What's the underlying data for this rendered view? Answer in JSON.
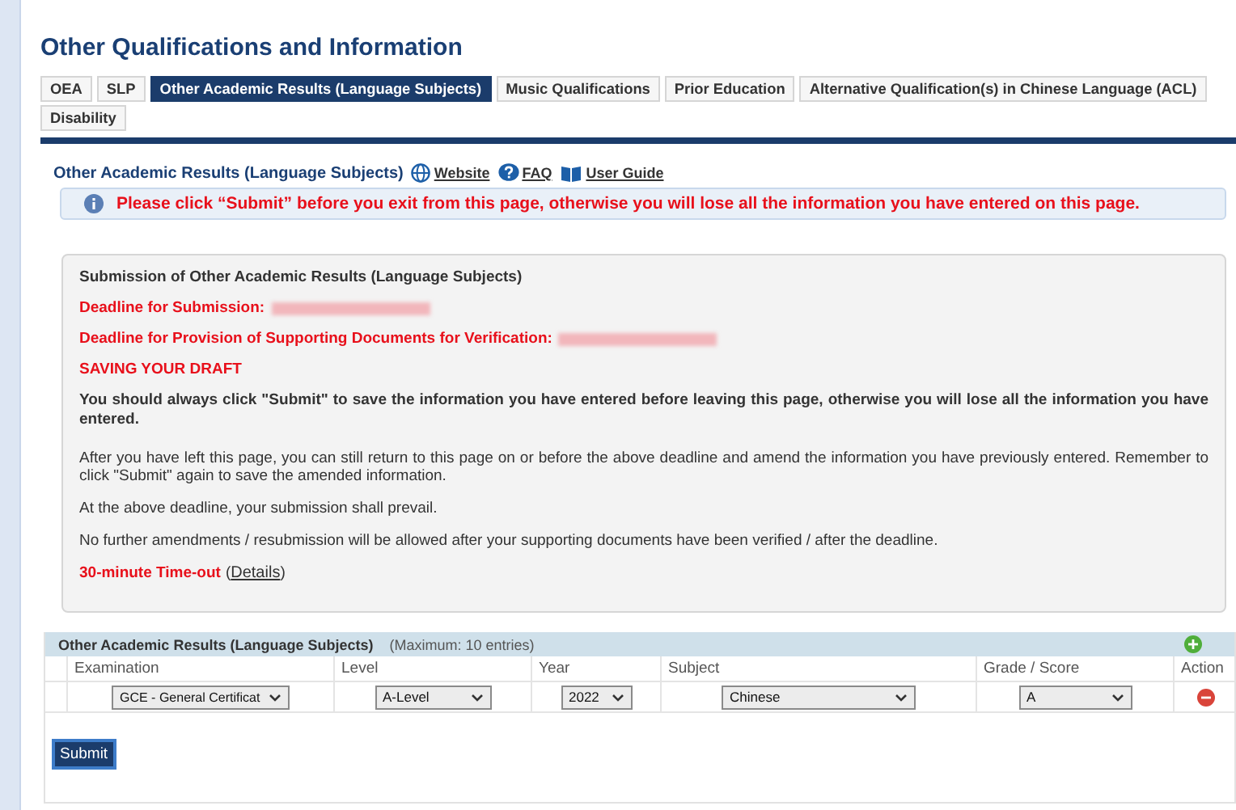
{
  "page_title": "Other Qualifications and Information",
  "tabs": [
    {
      "label": "OEA",
      "selected": false
    },
    {
      "label": "SLP",
      "selected": false
    },
    {
      "label": "Other Academic Results (Language Subjects)",
      "selected": true
    },
    {
      "label": "Music Qualifications",
      "selected": false
    },
    {
      "label": "Prior Education",
      "selected": false
    },
    {
      "label": "Alternative Qualification(s) in Chinese Language (ACL)",
      "selected": false
    },
    {
      "label": "Disability",
      "selected": false
    }
  ],
  "section": {
    "title": "Other Academic Results (Language Subjects)",
    "links": [
      {
        "kind": "website",
        "label": "Website"
      },
      {
        "kind": "faq",
        "label": "FAQ"
      },
      {
        "kind": "guide",
        "label": "User Guide"
      }
    ]
  },
  "alert": "Please click “Submit” before you exit from this page, otherwise you will lose all the information you have entered on this page.",
  "notice": {
    "heading": "Submission of Other Academic Results (Language Subjects)",
    "deadlines": [
      {
        "label": "Deadline for Submission:"
      },
      {
        "label": "Deadline for Provision of Supporting Documents for Verification:"
      }
    ],
    "draft_heading": "SAVING YOUR DRAFT",
    "warning": "You should always click \"Submit\" to save the information you have entered before leaving this page, otherwise you will lose all the information you have entered.",
    "paragraphs": [
      "After you have left this page, you can still return to this page on or before the above deadline and amend the information you have previously entered. Remember to click \"Submit\" again to save the amended information.",
      "At the above deadline, your submission shall prevail.",
      "No further amendments / resubmission will be allowed after your supporting documents have been verified / after the deadline."
    ],
    "timeout": "30-minute Time-out",
    "details_open": "(",
    "details_link": "Details",
    "details_close": ")"
  },
  "table": {
    "title": "Other Academic Results (Language Subjects)",
    "note": "(Maximum: 10 entries)",
    "columns": [
      "Examination",
      "Level",
      "Year",
      "Subject",
      "Grade / Score",
      "Action"
    ],
    "rows": [
      {
        "examination": "GCE - General Certificat",
        "level": "A-Level",
        "year": "2022",
        "subject": "Chinese",
        "grade": "A"
      }
    ]
  },
  "submit_button": "Submit"
}
